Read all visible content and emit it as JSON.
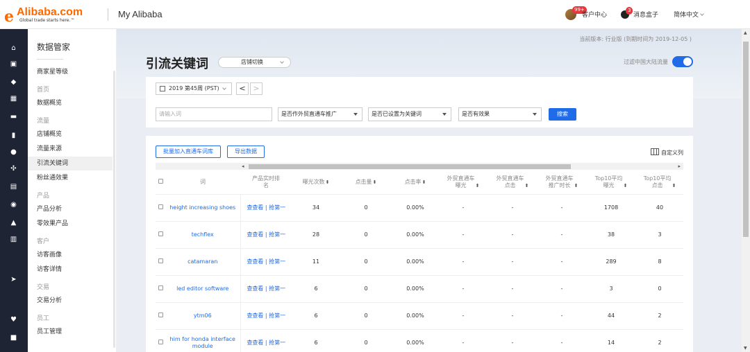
{
  "header": {
    "logo_text": "Alibaba.com",
    "logo_tagline": "Global trade starts here.™",
    "app_title": "My Alibaba",
    "customer_badge": "99+",
    "customer_center": "客户中心",
    "message_badge": "3",
    "message_box": "消息盒子",
    "language": "简体中文"
  },
  "menu": {
    "title": "数据管家",
    "items": [
      {
        "type": "item",
        "label": "商家星等级"
      },
      {
        "type": "group",
        "label": "首页"
      },
      {
        "type": "item",
        "label": "数据概览"
      },
      {
        "type": "group",
        "label": "流量"
      },
      {
        "type": "item",
        "label": "店铺概览"
      },
      {
        "type": "item",
        "label": "流量来源"
      },
      {
        "type": "item",
        "label": "引流关键词",
        "active": true
      },
      {
        "type": "item",
        "label": "粉丝通效果"
      },
      {
        "type": "group",
        "label": "产品"
      },
      {
        "type": "item",
        "label": "产品分析"
      },
      {
        "type": "item",
        "label": "零效果产品"
      },
      {
        "type": "group",
        "label": "客户"
      },
      {
        "type": "item",
        "label": "访客画像"
      },
      {
        "type": "item",
        "label": "访客详情"
      },
      {
        "type": "group",
        "label": "交易"
      },
      {
        "type": "item",
        "label": "交易分析"
      },
      {
        "type": "group",
        "label": "员工"
      },
      {
        "type": "item",
        "label": "员工管理"
      }
    ]
  },
  "main": {
    "version_note": "当前版本: 行业版 (到期时间为 2019-12-05 )",
    "page_title": "引流关键词",
    "store_switch": "店铺切换",
    "filter_mainland_label": "过滤中国大陆流量",
    "filter_mainland_on": true,
    "week_picker": "2019 第45周 (PST)",
    "prev_label": "<",
    "next_label": ">",
    "keyword_placeholder": "请输入词",
    "selects": [
      "是否作外贸直通车推广",
      "是否已设置为关键词",
      "是否有效果"
    ],
    "search_label": "搜索",
    "batch_add_label": "批量加入直通车词库",
    "export_label": "导出数据",
    "custom_columns_label": "自定义列"
  },
  "table": {
    "headers": [
      {
        "label": "",
        "sort": false
      },
      {
        "label": "词",
        "sort": false
      },
      {
        "label": "产品实时排名",
        "sort": false
      },
      {
        "label": "曝光次数",
        "sort": true
      },
      {
        "label": "点击量",
        "sort": true
      },
      {
        "label": "点击率",
        "sort": true
      },
      {
        "label": "外贸直通车曝光",
        "sort": true
      },
      {
        "label": "外贸直通车点击",
        "sort": true
      },
      {
        "label": "外贸直通车推广时长",
        "sort": true
      },
      {
        "label": "Top10平均曝光",
        "sort": true
      },
      {
        "label": "Top10平均点击",
        "sort": true
      }
    ],
    "rank_link": "查查看 | 抢第一",
    "rows": [
      {
        "keyword": "height increasing shoes",
        "impressions": "34",
        "clicks": "0",
        "ctr": "0.00%",
        "p4p_imp": "-",
        "p4p_clicks": "-",
        "p4p_duration": "-",
        "top10_imp": "1708",
        "top10_clicks": "40"
      },
      {
        "keyword": "techflex",
        "impressions": "28",
        "clicks": "0",
        "ctr": "0.00%",
        "p4p_imp": "-",
        "p4p_clicks": "-",
        "p4p_duration": "-",
        "top10_imp": "38",
        "top10_clicks": "3"
      },
      {
        "keyword": "catamaran",
        "impressions": "11",
        "clicks": "0",
        "ctr": "0.00%",
        "p4p_imp": "-",
        "p4p_clicks": "-",
        "p4p_duration": "-",
        "top10_imp": "289",
        "top10_clicks": "8"
      },
      {
        "keyword": "led editor software",
        "impressions": "6",
        "clicks": "0",
        "ctr": "0.00%",
        "p4p_imp": "-",
        "p4p_clicks": "-",
        "p4p_duration": "-",
        "top10_imp": "3",
        "top10_clicks": "0"
      },
      {
        "keyword": "ytm06",
        "impressions": "6",
        "clicks": "0",
        "ctr": "0.00%",
        "p4p_imp": "-",
        "p4p_clicks": "-",
        "p4p_duration": "-",
        "top10_imp": "44",
        "top10_clicks": "2"
      },
      {
        "keyword": "him for honda interface module",
        "impressions": "6",
        "clicks": "0",
        "ctr": "0.00%",
        "p4p_imp": "-",
        "p4p_clicks": "-",
        "p4p_duration": "-",
        "top10_imp": "14",
        "top10_clicks": "2"
      }
    ]
  },
  "colors": {
    "accent": "#1f6be8",
    "brand": "#ff6a00",
    "iconbar": "#1f2434"
  }
}
